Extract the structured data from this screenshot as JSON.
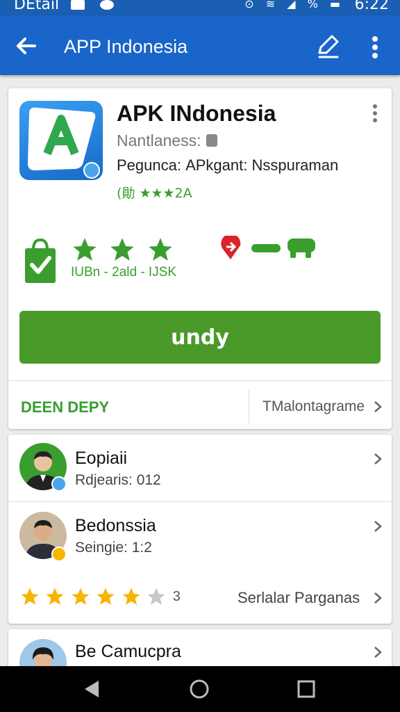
{
  "status_bar": {
    "left_label": "DEtail",
    "time": "6:22",
    "icons": "⊙ ≋ ◢ % ▬"
  },
  "app_bar": {
    "title": "APP Indonesia",
    "back_icon": "arrow-left-icon",
    "edit_icon": "pen-icon",
    "menu_icon": "more-vert-icon"
  },
  "app": {
    "name": "APK INdonesia",
    "developer_line": "Nantlaness:",
    "category_line": "Peguncа: APkgant: Nsspuraman",
    "rating_line": "(勛 ★★★2A",
    "stars_caption": "IUBn - 2ald - IJSK",
    "install_label": "undy",
    "footer_left": "DEEN DEPY",
    "footer_right": "TMalontagrame"
  },
  "reviews": [
    {
      "name": "Eopiaii",
      "sub": "Rdjearis: 012"
    },
    {
      "name": "Bedonssia",
      "sub": "Seingie: 1:2"
    },
    {
      "name": "Be Camucpra",
      "sub": ""
    }
  ],
  "rating_bar": {
    "stars": 5,
    "count": "3",
    "link": "Serlalar Parganas"
  },
  "colors": {
    "primary": "#1a65c9",
    "accent_green": "#4a9a2a",
    "star_yellow": "#f7b500"
  }
}
